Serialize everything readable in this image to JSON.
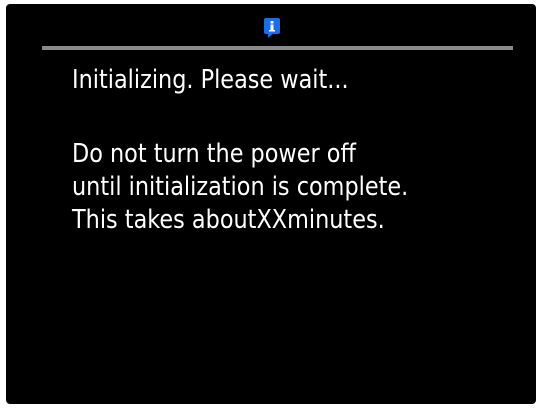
{
  "header": {
    "icon": "info-icon",
    "accent_color": "#1a6ee8"
  },
  "status": {
    "title": "Initializing. Please wait...",
    "lines": [
      "Do not turn the power off",
      "until initialization is complete.",
      "This takes aboutXXminutes."
    ]
  }
}
